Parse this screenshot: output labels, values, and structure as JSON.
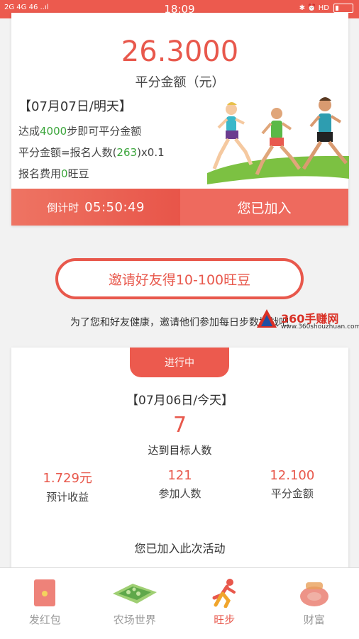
{
  "status_bar": {
    "left_indicators": "2G 4G 46 ..ıl",
    "time": "18:09",
    "right_indicators": "✱ ⏰ HD"
  },
  "tomorrow_card": {
    "amount": "26.3000",
    "amount_label": "平分金额（元）",
    "date": "【07月07日/明天】",
    "rule1_prefix": "达成",
    "rule1_steps": "4000",
    "rule1_suffix": "步即可平分金额",
    "rule2_prefix": "平分金额=报名人数(",
    "rule2_count": "263",
    "rule2_suffix": ")x0.1",
    "rule3_prefix": "报名费用",
    "rule3_fee": "0",
    "rule3_suffix": "旺豆",
    "countdown_label": "倒计时",
    "countdown_value": "05:50:49",
    "joined_button": "您已加入"
  },
  "invite": {
    "button": "邀请好友得10-100旺豆",
    "note": "为了您和好友健康，邀请他们参加每日步数挑战吧"
  },
  "watermark": {
    "brand": "360手赚网",
    "url": "www.360shouzhuan.com"
  },
  "today_card": {
    "status": "进行中",
    "date": "【07月06日/今天】",
    "reached_count": "7",
    "reached_label": "达到目标人数",
    "stats": [
      {
        "value": "1.729元",
        "label": "预计收益"
      },
      {
        "value": "121",
        "label": "参加人数"
      },
      {
        "value": "12.100",
        "label": "平分金额"
      }
    ],
    "joined_message": "您已加入此次活动"
  },
  "bottom_nav": {
    "items": [
      {
        "label": "发红包",
        "icon": "red-envelope-icon",
        "active": false
      },
      {
        "label": "农场世界",
        "icon": "farm-icon",
        "active": false
      },
      {
        "label": "旺步",
        "icon": "runner-icon",
        "active": true
      },
      {
        "label": "财富",
        "icon": "money-bag-icon",
        "active": false
      }
    ]
  },
  "colors": {
    "accent": "#e8584c",
    "header": "#ec5a4e",
    "highlight_green": "#3aa53a"
  }
}
